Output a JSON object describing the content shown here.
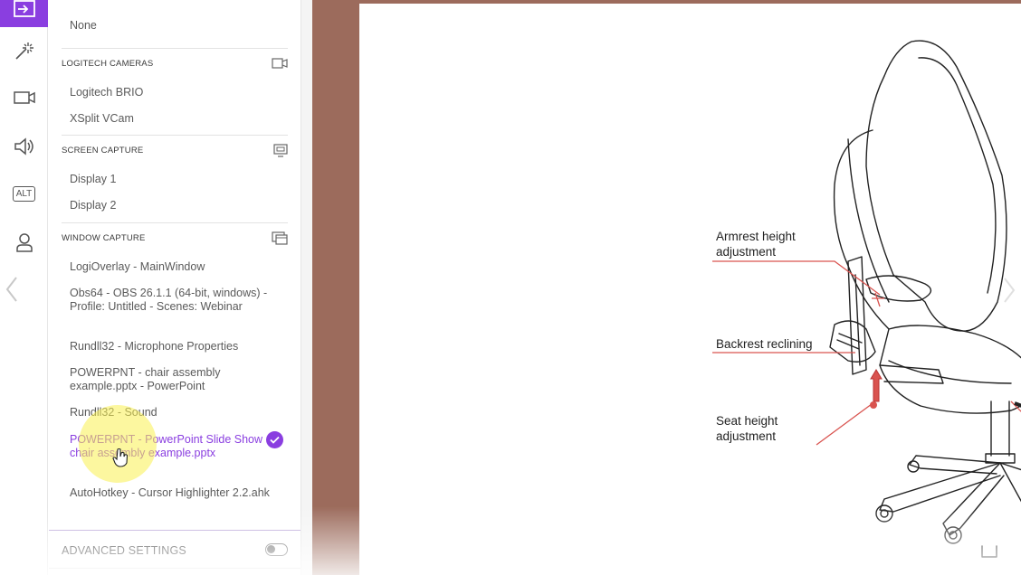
{
  "rail": {
    "items": [
      {
        "name": "sources-icon",
        "active": true
      },
      {
        "name": "effects-wand-icon",
        "active": false
      },
      {
        "name": "camera-icon",
        "active": false
      },
      {
        "name": "audio-icon",
        "active": false
      },
      {
        "name": "alt-text-icon",
        "label": "ALT",
        "active": false
      },
      {
        "name": "person-icon",
        "active": false
      }
    ],
    "back_icon": "chevron-left-icon"
  },
  "panel": {
    "top_item": "None",
    "sections": [
      {
        "title": "LOGITECH CAMERAS",
        "icon": "camera-icon",
        "items": [
          "Logitech BRIO",
          "XSplit VCam"
        ]
      },
      {
        "title": "SCREEN CAPTURE",
        "icon": "screen-capture-icon",
        "items": [
          "Display 1",
          "Display 2"
        ]
      },
      {
        "title": "WINDOW CAPTURE",
        "icon": "window-capture-icon",
        "items": [
          "LogiOverlay - MainWindow",
          "Obs64 - OBS 26.1.1 (64-bit, windows) - Profile: Untitled - Scenes: Webinar",
          "Rundll32 - Microphone Properties",
          "POWERPNT - chair assembly example.pptx - PowerPoint",
          "Rundll32 - Sound",
          "POWERPNT - PowerPoint Slide Show - chair assembly example.pptx",
          "AutoHotkey - Cursor Highlighter 2.2.ahk"
        ],
        "selected_index": 5
      }
    ],
    "advanced_settings": {
      "label": "ADVANCED SETTINGS",
      "enabled": false
    }
  },
  "slide": {
    "callouts": [
      {
        "text": "Armrest height adjustment"
      },
      {
        "text": "Backrest reclining"
      },
      {
        "text": "Seat height adjustment"
      }
    ]
  },
  "colors": {
    "accent": "#8a3ee0",
    "preview_border": "#9c6b5c",
    "callout_line": "#d9534f"
  }
}
